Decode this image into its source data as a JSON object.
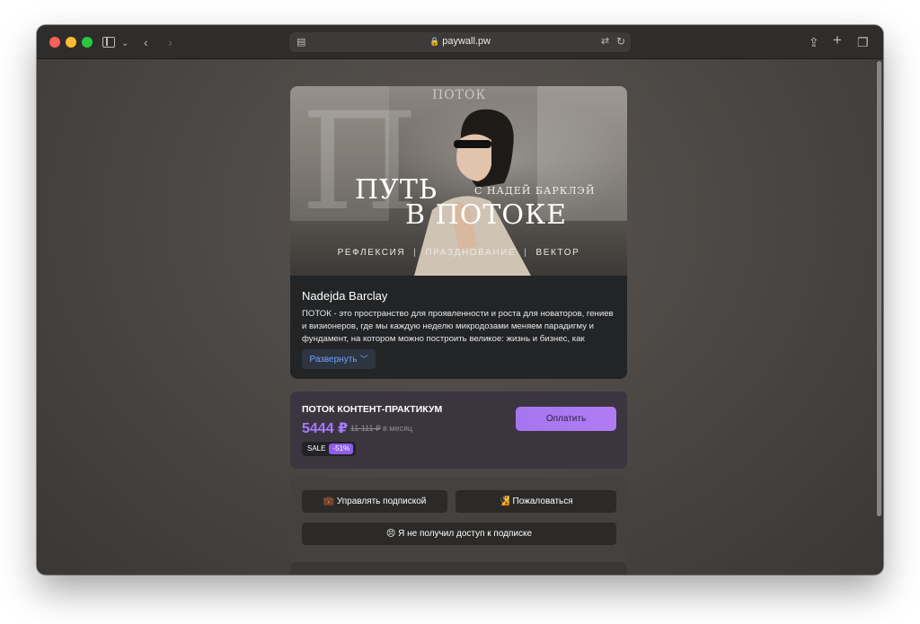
{
  "browser": {
    "url": "paywall.pw"
  },
  "hero": {
    "logo": "ПОТОК",
    "big_letter": "П",
    "title_line1": "ПУТЬ",
    "title_line2": "В ПОТОКЕ",
    "subtitle": "С НАДЕЙ БАРКЛЭЙ",
    "tags": [
      "РЕФЛЕКСИЯ",
      "ПРАЗДНОВАНИЕ",
      "ВЕКТОР"
    ],
    "tag_separator": "|"
  },
  "creator": {
    "name": "Nadejda Barclay",
    "description": "ПОТОК - это пространство для проявленности и роста для новаторов, гениев и визионеров, где мы каждую неделю микродозами меняем парадигму и фундамент, на котором можно построить великое: жизнь и бизнес, как",
    "expand_label": "Развернуть"
  },
  "plan": {
    "title": "ПОТОК КОНТЕНТ-ПРАКТИКУМ",
    "price": "5444 ₽",
    "old_price": "11 111 ₽",
    "period": "в месяц",
    "sale_label": "SALE",
    "discount": "-51%",
    "pay_label": "Оплатить"
  },
  "actions": {
    "manage_label": "💼 Управлять подпиской",
    "report_label": "🧏 Пожаловаться",
    "noaccess_label": "😣 Я не получил доступ к подписке"
  },
  "colors": {
    "accent": "#a67bff",
    "link": "#6ea3ff",
    "card_bg": "#232426",
    "plan_bg": "#3b3540"
  }
}
